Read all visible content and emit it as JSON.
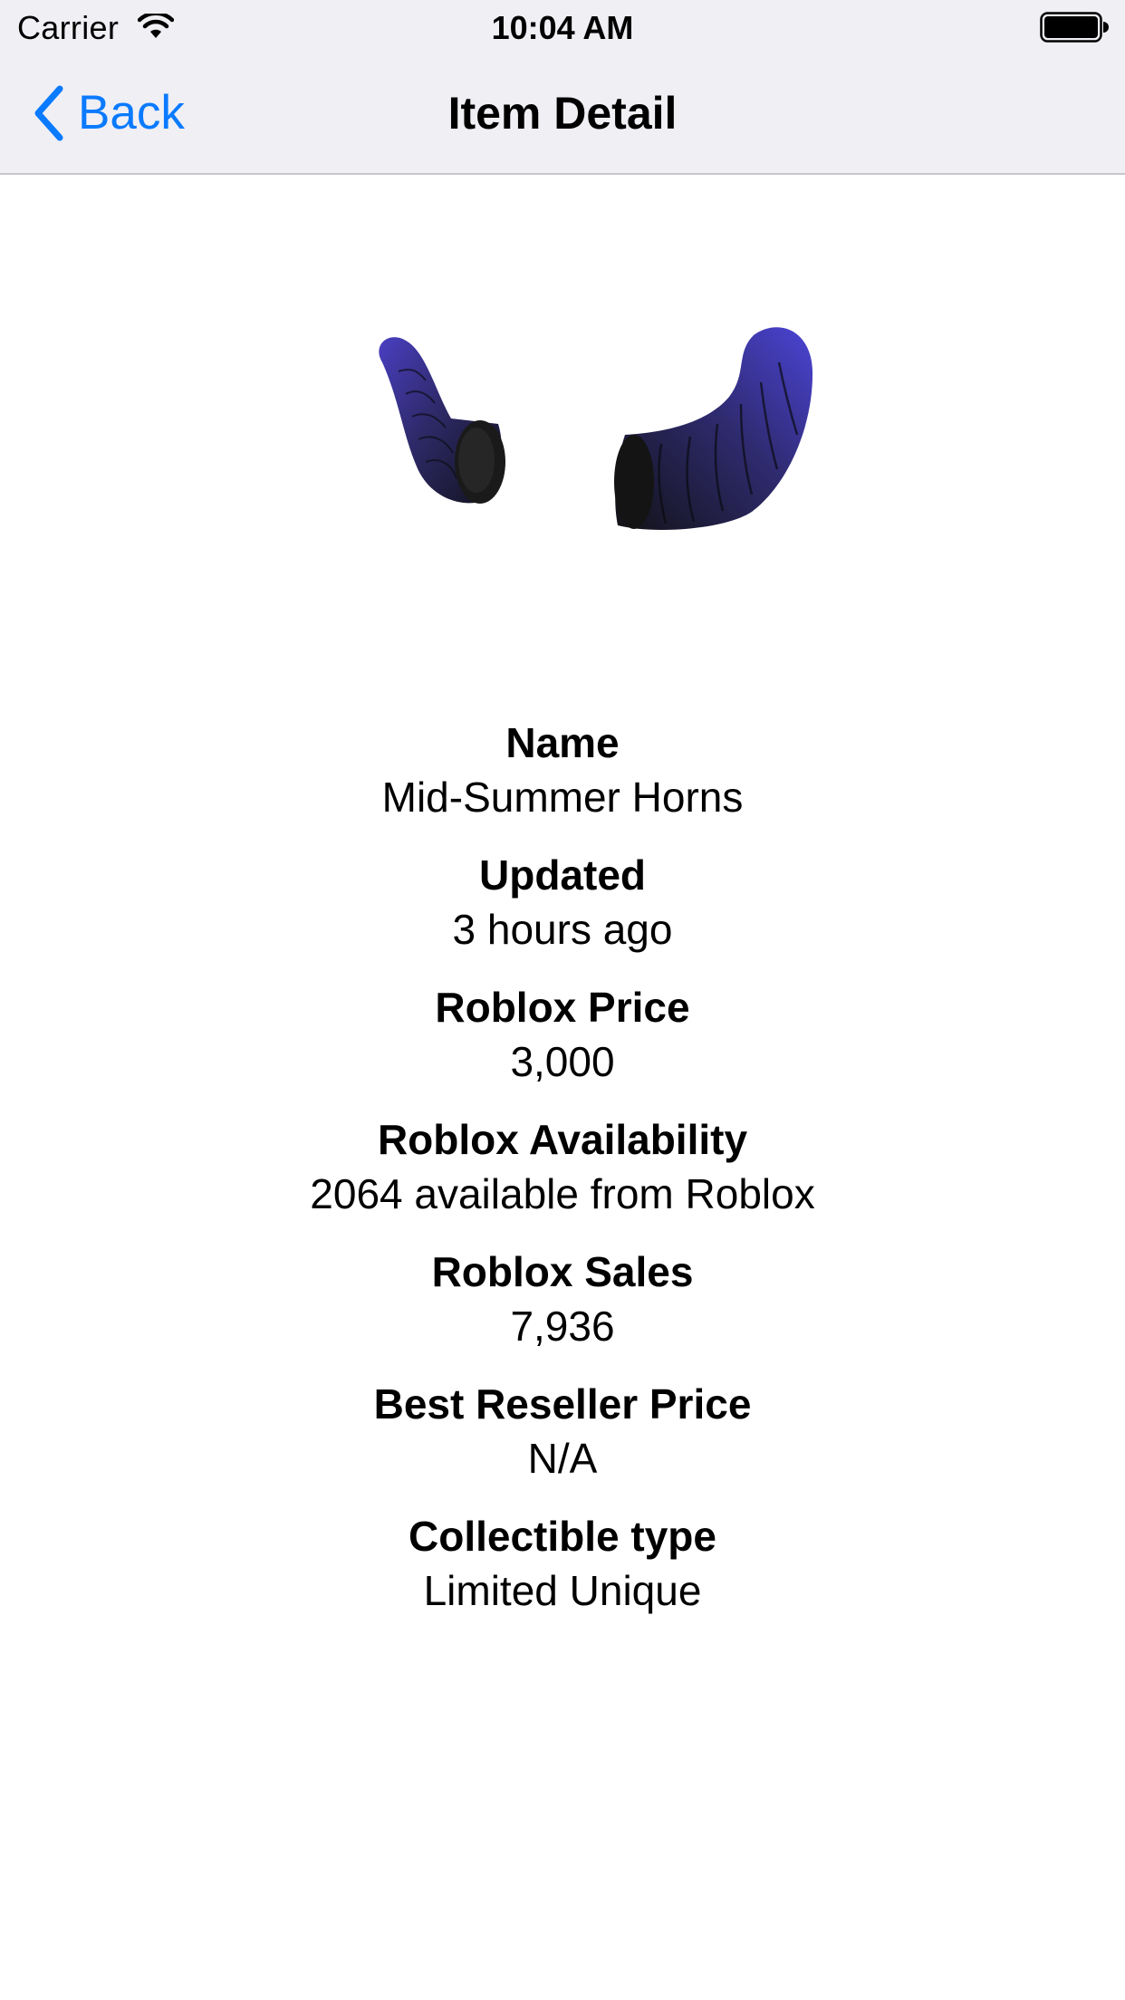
{
  "status_bar": {
    "carrier": "Carrier",
    "time": "10:04 AM",
    "wifi_icon": "wifi-icon",
    "battery_icon": "battery-icon"
  },
  "nav": {
    "back_label": "Back",
    "back_icon": "chevron-left-icon",
    "title": "Item Detail",
    "accent_color": "#0a7aff"
  },
  "item": {
    "image_icon": "horns-image",
    "fields": [
      {
        "label": "Name",
        "value": "Mid-Summer Horns"
      },
      {
        "label": "Updated",
        "value": "3 hours ago"
      },
      {
        "label": "Roblox Price",
        "value": "3,000"
      },
      {
        "label": "Roblox Availability",
        "value": "2064 available from Roblox"
      },
      {
        "label": "Roblox Sales",
        "value": "7,936"
      },
      {
        "label": "Best Reseller Price",
        "value": "N/A"
      },
      {
        "label": "Collectible type",
        "value": "Limited Unique"
      }
    ]
  }
}
